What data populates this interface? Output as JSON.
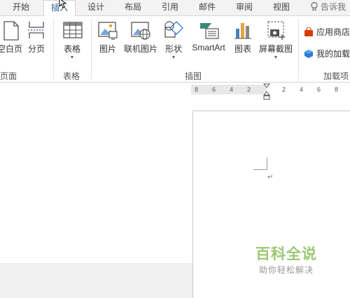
{
  "tabs": [
    {
      "label": "开始"
    },
    {
      "label": "插入",
      "active": true
    },
    {
      "label": "设计"
    },
    {
      "label": "布局"
    },
    {
      "label": "引用"
    },
    {
      "label": "邮件"
    },
    {
      "label": "审阅"
    },
    {
      "label": "视图"
    }
  ],
  "tell_me": "告诉我",
  "ribbon": {
    "pages_group": {
      "blank_page": "空白页",
      "page_break": "分页",
      "label": "页面"
    },
    "tables_group": {
      "table": "表格",
      "label": "表格"
    },
    "illustrations_group": {
      "picture": "图片",
      "online_picture": "联机图片",
      "shapes": "形状",
      "smartart": "SmartArt",
      "chart": "图表",
      "screenshot": "屏幕截图",
      "label": "插图"
    },
    "addins_group": {
      "store": "应用商店",
      "my_addins": "我的加载",
      "label": "加载项"
    }
  },
  "ruler_ticks": [
    "8",
    "6",
    "4",
    "2",
    "2",
    "4",
    "6",
    "8"
  ],
  "paragraph_mark": "↵",
  "watermark": {
    "title": "百科全说",
    "subtitle": "助你轻松解决"
  },
  "colors": {
    "accent": "#2b579a",
    "watermark_green": "#9cc873",
    "store_red": "#d83b01",
    "addin_blue": "#2b7cd3"
  }
}
